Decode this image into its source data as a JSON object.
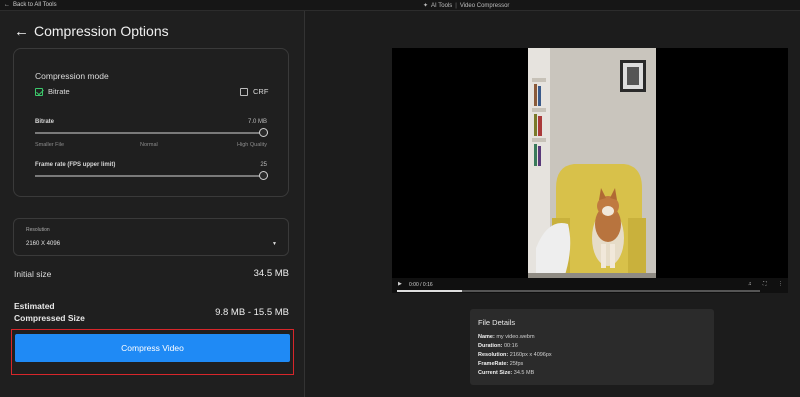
{
  "topbar": {
    "back_label": "Back to All Tools",
    "breadcrumb_root": "AI Tools",
    "breadcrumb_sep": "|",
    "breadcrumb_current": "Video Compressor"
  },
  "panel": {
    "title": "Compression Options",
    "mode": {
      "label": "Compression mode",
      "bitrate_label": "Bitrate",
      "bitrate_checked": true,
      "crf_label": "CRF",
      "crf_checked": false
    },
    "bitrate": {
      "label": "Bitrate",
      "value": "7.0 MB",
      "position_fraction": 0.99,
      "min_label": "Smaller File",
      "mid_label": "Normal",
      "max_label": "High Quality"
    },
    "frame_rate": {
      "label": "Frame rate (FPS upper limit)",
      "value": "25",
      "position_fraction": 1.0
    },
    "resolution": {
      "label": "Resolution",
      "value": "2160 X 4096"
    },
    "initial_size": {
      "label": "Initial size",
      "value": "34.5 MB"
    },
    "estimated": {
      "label_line1": "Estimated",
      "label_line2": "Compressed Size",
      "value": "9.8 MB - 15.5 MB"
    },
    "compress_button": "Compress Video"
  },
  "player": {
    "time": "0:00 / 0:16",
    "progress_fraction": 0.18
  },
  "file_details": {
    "title": "File Details",
    "name_key": "Name:",
    "name_val": "my video.webm",
    "duration_key": "Duration:",
    "duration_val": "00:16",
    "resolution_key": "Resolution:",
    "resolution_val": "2160px x 4096px",
    "framerate_key": "FrameRate:",
    "framerate_val": "25fps",
    "size_key": "Current Size:",
    "size_val": "34.5 MB"
  },
  "colors": {
    "accent": "#1f8af5",
    "check": "#3cc96b",
    "highlight_frame": "#d7262a"
  }
}
